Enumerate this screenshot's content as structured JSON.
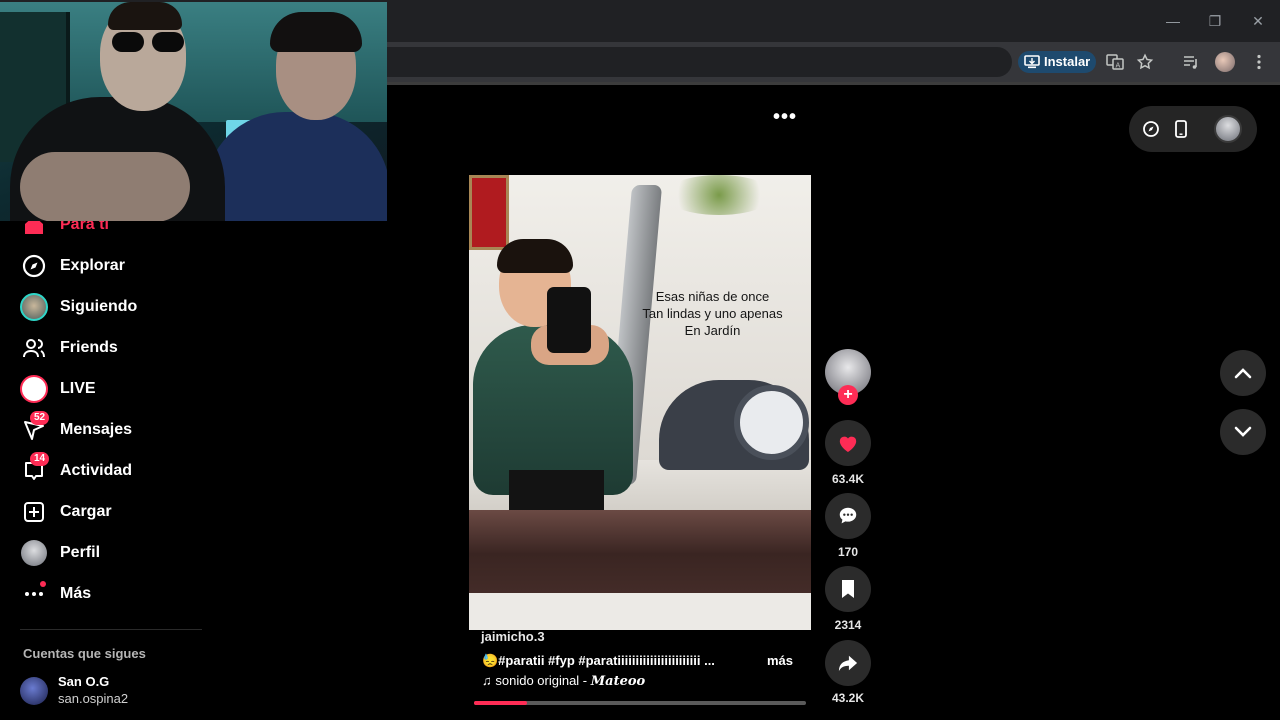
{
  "browser": {
    "install_label": "Instalar"
  },
  "sidebar": {
    "items": [
      {
        "label": "Para ti"
      },
      {
        "label": "Explorar"
      },
      {
        "label": "Siguiendo"
      },
      {
        "label": "Friends"
      },
      {
        "label": "LIVE"
      },
      {
        "label": "Mensajes",
        "badge": "52"
      },
      {
        "label": "Actividad",
        "badge": "14"
      },
      {
        "label": "Cargar"
      },
      {
        "label": "Perfil"
      },
      {
        "label": "Más"
      }
    ],
    "following_heading": "Cuentas que sigues",
    "accounts": [
      {
        "name": "San O.G",
        "handle": "san.ospina2"
      }
    ]
  },
  "video": {
    "caption_lines": [
      "Esas niñas de once",
      "Tan lindas y uno apenas",
      "En Jardín"
    ],
    "username": "jaimicho.3",
    "description": "😓#paratii  #fyp  #paratiiiiiiiiiiiiiiiiiiiiiii  ...",
    "more_label": "más",
    "sound_prefix": "♫  sonido original - ",
    "sound_author": "𝑴𝒂𝒕𝒆𝒐𝒐",
    "progress": 0.16
  },
  "actions": {
    "likes": "63.4K",
    "comments": "170",
    "saves": "2314",
    "shares": "43.2K"
  },
  "colors": {
    "accent": "#fe2c55",
    "background": "#000000"
  }
}
